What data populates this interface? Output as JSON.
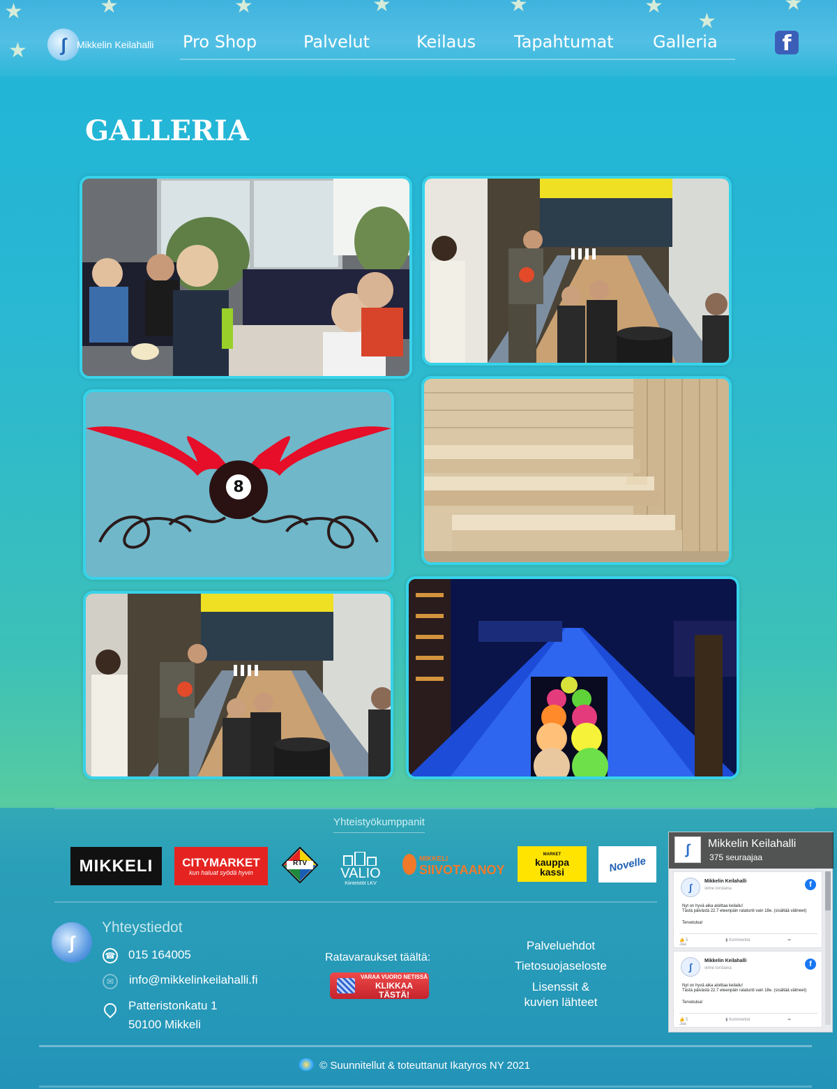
{
  "header": {
    "logo_text": "Mikkelin Keilahalli",
    "nav": [
      "Pro Shop",
      "Palvelut",
      "Keilaus",
      "Tapahtumat",
      "Galleria"
    ],
    "facebook_icon": "facebook-icon"
  },
  "page": {
    "title": "GALLERIA"
  },
  "gallery": {
    "photos": [
      {
        "name": "kids-at-table-photo"
      },
      {
        "name": "bowling-lane-kids-photo"
      },
      {
        "name": "winged-eight-ball-logo"
      },
      {
        "name": "sauna-photo"
      },
      {
        "name": "bowling-lane-kids-photo-2"
      },
      {
        "name": "blacklight-lanes-photo"
      }
    ]
  },
  "partners": {
    "title": "Yhteistyökumppanit",
    "logos": [
      "MIKKELI",
      "CITYMARKET",
      "RTV",
      "VALIO",
      "SIIVOTAANOY",
      "kauppa kassi",
      "Novelle"
    ],
    "citymarket_tagline": "kun haluat syödä hyvin",
    "valio_sub": "Kiinteistöt LKV",
    "siivotaan_top": "MIKKELI",
    "kauppa_top": "MARKET"
  },
  "contact": {
    "title": "Yhteystiedot",
    "phone": "015 164005",
    "email": "info@mikkelinkeilahalli.fi",
    "address_line1": "Patteristonkatu 1",
    "address_line2": "50100 Mikkeli"
  },
  "booking": {
    "label": "Ratavaraukset täältä:",
    "button_line1": "VARAA VUORO NETISSÄ",
    "button_line2": "KLIKKAA TÄSTÄ!"
  },
  "links": {
    "terms": "Palveluehdot",
    "privacy": "Tietosuojaseloste",
    "licenses_line1": "Lisenssit &",
    "licenses_line2": "kuvien lähteet"
  },
  "facebook_widget": {
    "page_name": "Mikkelin Keilahalli",
    "followers": "375 seuraajaa",
    "posts": [
      {
        "author": "Mikkelin Keilahalli",
        "time": "viime torstaina",
        "text_line1": "Nyt on hyvä aika aloittaa keilailu!",
        "text_line2": "Tästä päivästä 22.7 eteenpäin ratatunti vain 18e. (sisältää välineet)",
        "welcome": "Tervetuloa!",
        "likes": "5",
        "comment": "Kommentoi",
        "share": "Jaa"
      },
      {
        "author": "Mikkelin Keilahalli",
        "time": "viime torstaina",
        "text_line1": "Nyt on hyvä aika aloittaa keilailu!",
        "text_line2": "Tästä päivästä 22.7 eteenpäin ratatunti vain 18e. (sisältää välineet)",
        "welcome": "Tervetuloa!",
        "likes": "5",
        "comment": "Kommentoi",
        "share": "Jaa"
      }
    ]
  },
  "footer": {
    "copyright": "© Suunnitellut & toteuttanut Ikatyros NY 2021"
  }
}
